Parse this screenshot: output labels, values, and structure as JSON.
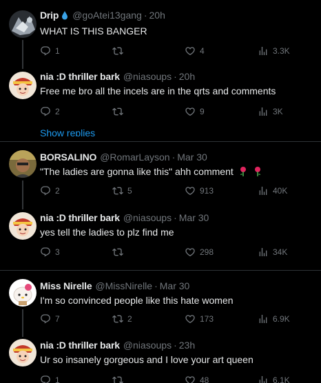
{
  "tweets": [
    {
      "name": "Drip",
      "handle": "@goAtei13gang",
      "time": "20h",
      "text": "WHAT IS THIS BANGER",
      "replies": "1",
      "retweets": "",
      "likes": "4",
      "views": "3.3K"
    },
    {
      "name": "nia :D thriller bark",
      "handle": "@niasoups",
      "time": "20h",
      "text": "Free me bro all the incels are in the qrts and comments",
      "replies": "2",
      "retweets": "",
      "likes": "9",
      "views": "3K"
    },
    {
      "name": "BORSALINO",
      "handle": "@RomarLayson",
      "time": "Mar 30",
      "text": "\"The ladies are gonna like this\" ahh comment",
      "replies": "2",
      "retweets": "5",
      "likes": "913",
      "views": "40K"
    },
    {
      "name": "nia :D thriller bark",
      "handle": "@niasoups",
      "time": "Mar 30",
      "text": "yes tell the ladies to plz find me",
      "replies": "3",
      "retweets": "",
      "likes": "298",
      "views": "34K"
    },
    {
      "name": "Miss Nirelle",
      "handle": "@MissNirelle",
      "time": "Mar 30",
      "text": "I'm so convinced people like this hate women",
      "replies": "7",
      "retweets": "2",
      "likes": "173",
      "views": "6.9K"
    },
    {
      "name": "nia :D thriller bark",
      "handle": "@niasoups",
      "time": "23h",
      "text": "Ur so insanely gorgeous and I love your art queen",
      "replies": "1",
      "retweets": "",
      "likes": "48",
      "views": "6.1K"
    }
  ],
  "show_replies_label": "Show replies",
  "separator": "·",
  "icons": {
    "reply": "reply-icon",
    "retweet": "retweet-icon",
    "like": "heart-icon",
    "views": "views-icon",
    "verified": "water-drop-icon",
    "emoji": "rose-icon"
  },
  "colors": {
    "background": "#000000",
    "text": "#e7e9ea",
    "muted": "#71767b",
    "divider": "#2f3336",
    "link": "#1d9bf0"
  }
}
